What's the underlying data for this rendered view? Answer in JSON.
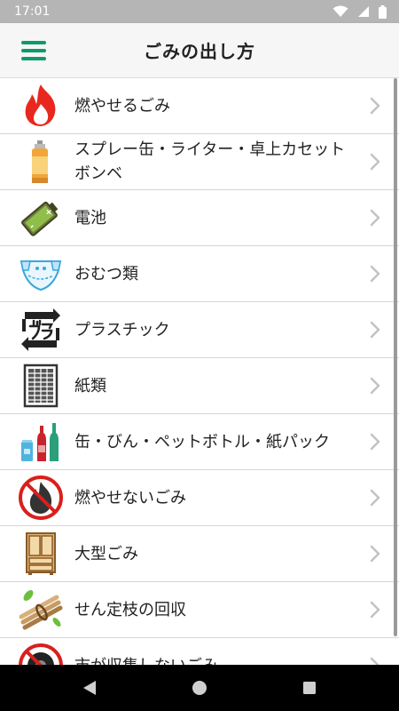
{
  "status_bar": {
    "time": "17:01"
  },
  "app_bar": {
    "title": "ごみの出し方"
  },
  "list": {
    "items": [
      {
        "label": "燃やせるごみ",
        "icon": "flame-icon"
      },
      {
        "label": "スプレー缶・ライター・卓上カセットボンベ",
        "icon": "spray-can-icon"
      },
      {
        "label": "電池",
        "icon": "battery-icon"
      },
      {
        "label": "おむつ類",
        "icon": "diaper-icon"
      },
      {
        "label": "プラスチック",
        "icon": "plastic-recycle-icon"
      },
      {
        "label": "紙類",
        "icon": "paper-icon"
      },
      {
        "label": "缶・びん・ペットボトル・紙パック",
        "icon": "bottles-icon"
      },
      {
        "label": "燃やせないごみ",
        "icon": "no-burn-icon"
      },
      {
        "label": "大型ごみ",
        "icon": "cabinet-icon"
      },
      {
        "label": "せん定枝の回収",
        "icon": "branches-icon"
      },
      {
        "label": "市が収集しないごみ",
        "icon": "no-tire-icon"
      }
    ]
  },
  "colors": {
    "accent": "#0f9a6e",
    "flame": "#e8281e",
    "prohibited": "#d9201c",
    "status_bar": "#b5b5b5",
    "nav_bar": "#000000"
  }
}
